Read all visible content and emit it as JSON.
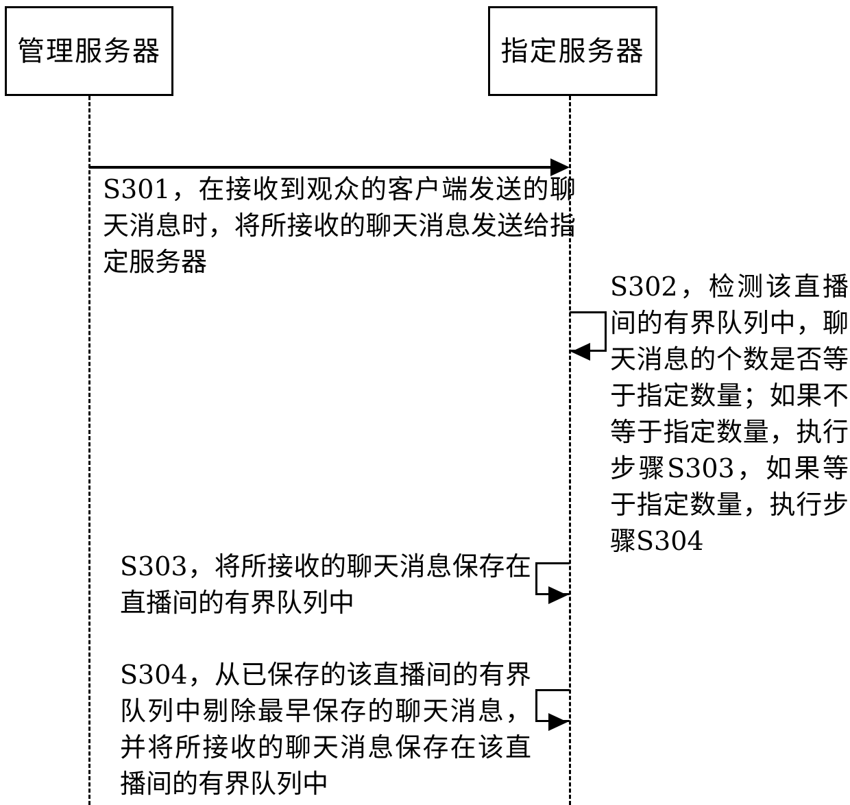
{
  "diagram": {
    "type": "uml-sequence-diagram",
    "participants": [
      {
        "id": "management_server",
        "label": "管理服务器"
      },
      {
        "id": "designated_server",
        "label": "指定服务器"
      }
    ],
    "steps": [
      {
        "id": "S301",
        "kind": "message",
        "from": "management_server",
        "to": "designated_server",
        "text": "S301，在接收到观众的客户端发送的聊天消息时，将所接收的聊天消息发送给指定服务器"
      },
      {
        "id": "S302",
        "kind": "self-message",
        "from": "designated_server",
        "to": "designated_server",
        "text": "S302，检测该直播间的有界队列中，聊天消息的个数是否等于指定数量；如果不等于指定数量，执行步骤S303，如果等于指定数量，执行步骤S304"
      },
      {
        "id": "S303",
        "kind": "self-message",
        "from": "designated_server",
        "to": "designated_server",
        "text": "S303，将所接收的聊天消息保存在直播间的有界队列中"
      },
      {
        "id": "S304",
        "kind": "self-message",
        "from": "designated_server",
        "to": "designated_server",
        "text": "S304，从已保存的该直播间的有界队列中剔除最早保存的聊天消息，并将所接收的聊天消息保存在该直播间的有界队列中"
      }
    ],
    "colors": {
      "stroke": "#000000",
      "background": "#ffffff"
    }
  }
}
